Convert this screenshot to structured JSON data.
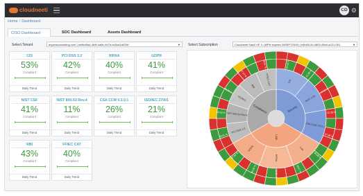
{
  "app": {
    "logo_text": "cloudneeti",
    "avatar_initials": "CD"
  },
  "breadcrumb": {
    "home": "Home",
    "current": "Dashboard"
  },
  "tabs": [
    {
      "label": "CISO Dashboard",
      "active": true
    },
    {
      "label": "SOC Dashboard",
      "active": false
    },
    {
      "label": "Assets Dashboard",
      "active": false
    }
  ],
  "tenant": {
    "label": "Select Tenant",
    "value": "avyansconsulting.com | bd9bd5a4-4b9f-4a5e-947b-bd3ca1a57f4f"
  },
  "subscription": {
    "label": "Select Subscription",
    "value": "Cloudneeti SaaS VE 3- (MPN expires 24SEPT2019) | b4b05119-4803-45b0-a221-091"
  },
  "cards": [
    {
      "title": "CIS",
      "percent": "53%",
      "status": "Compliant",
      "footer": "Daily Trend"
    },
    {
      "title": "PCI DSS 3.2",
      "percent": "42%",
      "status": "Compliant",
      "footer": "Daily Trend"
    },
    {
      "title": "HIPAA",
      "percent": "40%",
      "status": "Compliant",
      "footer": "Daily Trend"
    },
    {
      "title": "GDPR",
      "percent": "41%",
      "status": "Compliant",
      "footer": "Daily Trend"
    },
    {
      "title": "NIST CSF",
      "percent": "41%",
      "status": "Compliant",
      "footer": "Daily Trend"
    },
    {
      "title": "NIST 800-53 Rev.4",
      "percent": "11%",
      "status": "Compliant",
      "footer": "Daily Trend"
    },
    {
      "title": "CSA CCM V.3.0.1",
      "percent": "26%",
      "status": "Compliant",
      "footer": "Daily Trend"
    },
    {
      "title": "ISO/IEC 27001",
      "percent": "21%",
      "status": "Compliant",
      "footer": "Daily Trend"
    },
    {
      "title": "RBI",
      "percent": "43%",
      "status": "Compliant",
      "footer": "Daily Trend"
    },
    {
      "title": "FFIEC CAT",
      "percent": "40%",
      "status": "Compliant",
      "footer": "Daily Trend"
    }
  ],
  "sunburst": {
    "center_label": "Compliance",
    "inner": [
      {
        "label": "Security",
        "color": "#7f9bd6"
      },
      {
        "label": "Law",
        "color": "#f2a57e"
      },
      {
        "label": "Compliance",
        "color": "#a9a9a9"
      }
    ],
    "middle": [
      {
        "label": "CIS",
        "color": "#95addf"
      },
      {
        "label": "NIST CSF",
        "color": "#8aa5dc"
      },
      {
        "label": "CSA CCM V.3.0.1",
        "color": "#7e9cd9"
      },
      {
        "label": "Law",
        "color": "#f4b08d"
      },
      {
        "label": "HIPAA",
        "color": "#f6b997"
      },
      {
        "label": "GDPR",
        "color": "#f3ac87"
      },
      {
        "label": "PCI DSS 3.2",
        "color": "#bdbdbd"
      },
      {
        "label": "NIST 800-53 Rev.4",
        "color": "#b3b3b3"
      },
      {
        "label": "ISO/IEC",
        "color": "#c4c4c4"
      },
      {
        "label": "RBI",
        "color": "#bbbbbb"
      },
      {
        "label": "FFIEC CAT",
        "color": "#c0c0c0"
      }
    ],
    "outer_labels": [
      "64.52 %",
      "41.38 %",
      "47.62 %",
      "52.38 %",
      "97.85 %",
      "40.98 %",
      "28.57 %",
      "62.50 %",
      "40.00 %",
      "47.62 %",
      "25.01 %",
      "64.52 %",
      "40.00 %",
      "57.14 %",
      "66.67 %"
    ],
    "colors": {
      "red": "#d9322e",
      "green": "#3e9a3e",
      "yellow": "#f2c400"
    }
  }
}
